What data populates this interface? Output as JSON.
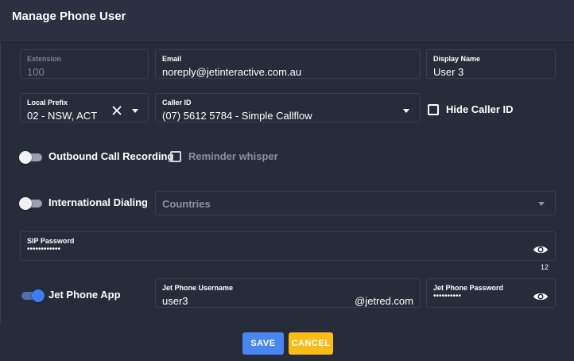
{
  "dialog": {
    "title": "Manage Phone User"
  },
  "extension": {
    "label": "Extension",
    "value": "100"
  },
  "email": {
    "label": "Email",
    "value": "noreply@jetinteractive.com.au"
  },
  "display_name": {
    "label": "Display Name",
    "value": "User 3"
  },
  "local_prefix": {
    "label": "Local Prefix",
    "value": "02 - NSW, ACT"
  },
  "caller_id": {
    "label": "Caller ID",
    "value": "(07) 5612 5784 - Simple Callflow"
  },
  "hide_caller_id": {
    "label": "Hide Caller ID",
    "checked": false
  },
  "outbound_recording": {
    "label": "Outbound Call Recording",
    "on": false
  },
  "reminder_whisper": {
    "label": "Reminder whisper",
    "checked": false
  },
  "international_dialing": {
    "label": "International Dialing",
    "on": false
  },
  "countries": {
    "placeholder": "Countries"
  },
  "sip_password": {
    "label": "SIP Password",
    "value": "••••••••••••",
    "counter": "12"
  },
  "jet_phone_app": {
    "label": "Jet Phone App",
    "on": true
  },
  "jet_phone_username": {
    "label": "Jet Phone Username",
    "value": "user3",
    "suffix": "@jetred.com"
  },
  "jet_phone_password": {
    "label": "Jet Phone Password",
    "value": "••••••••••"
  },
  "actions": {
    "save_label": "SAVE",
    "cancel_label": "CANCEL"
  },
  "icons": {
    "clear": "close-icon",
    "dropdown": "chevron-down-icon",
    "visibility": "eye-icon"
  },
  "colors": {
    "background": "#262c39",
    "header": "#2b3140",
    "save": "#4a86f0",
    "cancel": "#fbbb19",
    "toggle_on": "#3f7cf3"
  }
}
